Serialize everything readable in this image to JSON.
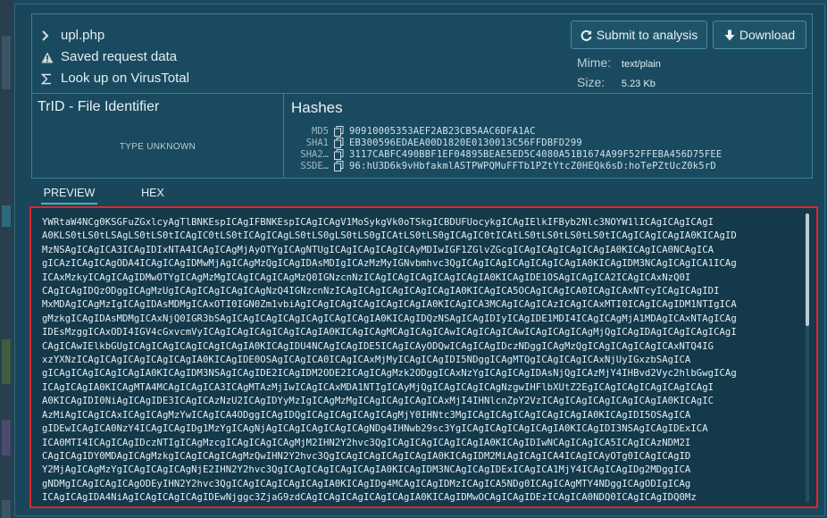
{
  "file": {
    "name": "upl.php",
    "actions": [
      {
        "label": "Saved request data",
        "icon": "warning-icon"
      },
      {
        "label": "Look up on VirusTotal",
        "icon": "sigma-icon"
      }
    ]
  },
  "buttons": {
    "submit_label": "Submit to analysis",
    "download_label": "Download"
  },
  "meta": {
    "mime_label": "Mime:",
    "mime_value": "text/plain",
    "size_label": "Size:",
    "size_value": "5.23 Kb"
  },
  "trid": {
    "title": "TrID - File Identifier",
    "type_text": "TYPE UNKNOWN"
  },
  "hashes": {
    "title": "Hashes",
    "rows": [
      {
        "label": "MD5",
        "value": "90910005353AEF2AB23CB5AAC6DFA1AC"
      },
      {
        "label": "SHA1",
        "value": "EB300596EDAEA00D1820E0130013C56FFDBFD299"
      },
      {
        "label": "SHA2…",
        "value": "3117CABFC490BBF1EF04895BEAE5ED5C4080A51B1674A99F52FFEBA456D75FEE"
      },
      {
        "label": "SSDE…",
        "value": "96:hU3D6k9vHbfakmlASTPWPQMuFFTb1PZtYtcZ0HEQk6sD:hoTePZtUcZ0k5rD"
      }
    ]
  },
  "tabs": {
    "preview": "PREVIEW",
    "hex": "HEX"
  },
  "preview": {
    "lines": [
      "YWRtaW4NCg0KSGFuZGxlcyAgTlBNKEspICAgIFBNKEspICAgICAgV1MoSykgVk0oTSkgICBDUFUocykgICAgIElkIFByb2Nlc3NOYW1lICAgICAgICAgI",
      "A0KLS0tLS0tLSAgLS0tLS0tICAgIC0tLS0tICAgICAgLS0tLS0gLS0tLS0gICAtLS0tLS0gICAgIC0tICAtLS0tLS0tLS0tLS0tICAgICAgICAgIA0KICAgID",
      "MzNSAgICAgICA3ICAgIDIxNTA4ICAgICAgMjAyOTYgICAgNTUgICAgICAgICAgICAyMDIwIGF1ZGlvZGcgICAgICAgICAgICAgIA0KICAgICA0NCAgICA",
      "gICAzICAgICAgODA4ICAgICAgIDMwMjAgICAgMzQgICAgIDAsMDIgICAzMzMyIGNvbmhvc3QgICAgICAgICAgICAgICAgIA0KICAgIDM3NCAgICAgICA1ICAg",
      "ICAxMzkyICAgICAgIDMwOTYgICAgMzMgICAgICAgICAgMzQ0IGNzcnNzICAgICAgICAgICAgICAgIA0KICAgIDE1OSAgICAgICA2ICAgICAxNzQ0I",
      "CAgICAgIDQzODggICAgMzUgICAgICAgICAgICAgNzQ4IGNzcnNzICAgICAgICAgICAgICAgIA0KICAgICA5OCAgICAgICA0ICAgICAxNTcyICAgICAgIDI",
      "MxMDAgICAgMzIgICAgIDAsMDMgICAxOTI0IGN0Zm1vbiAgICAgICAgICAgICAgICAgIA0KICAgICA3MCAgICAgICAzICAgICAxMTI0ICAgICAgIDM1NTIgICA",
      "gMzkgICAgIDAsMDMgICAxNjQ0IGR3bSAgICAgICAgICAgICAgICAgICAgIA0KICAgIDQzNSAgICAgIDIyICAgIDE1MDI4ICAgICAgMjA1MDAgICAxNTAgICAg",
      "IDEsMzggICAxODI4IGV4cGxvcmVyICAgICAgICAgICAgICAgIA0KICAgICAgMCAgICAgICAwICAgICAgICAwICAgICAgICAgMjQgICAgIDAgICAgICAgICAgI",
      "CAgICAwIElkbGUgICAgICAgICAgICAgICAgIA0KICAgIDU4NCAgICAgIDE5ICAgICAyODQwICAgICAgIDczNDggICAgMzQgICAgICAgICAgICAxNTQ4IG",
      "xzYXNzICAgICAgICAgICAgICAgIA0KICAgIDE0OSAgICAgICA0ICAgICAxMjMyICAgICAgIDI5NDggICAgMTQgICAgICAgICAxNjUyIGxzbSAgICA",
      "gICAgICAgICAgICAgIA0KICAgIDM3NSAgICAgIDE2ICAgIDM2ODE2ICAgICAgMzk2ODggICAxNzYgICAgICAgIDAsNjQgICAzMjY4IHBvd2Vyc2hlbGwgICAg",
      "ICAgICAgIA0KICAgMTA4MCAgICAgICA3ICAgMTAzMjIwICAgICAxMDA1NTIgICAyMjQgICAgICAgICAgNzgwIHFlbXUtZ2EgICAgICAgICAgICAgICAgI",
      "A0KICAgIDI0NiAgICAgIDE3ICAgICAzNzU2ICAgIDYyMzIgICAgMzMgICAgICAgICAgICAxMjI4IHNlcnZpY2VzICAgICAgICAgICAgICAgIA0KICAgIC",
      "AzMiAgICAgICAxICAgICAgMzYwICAgICA4ODggICAgIDQgICAgICAgICAgICAgMjY0IHNtc3MgICAgICAgICAgICAgICAgIA0KICAgIDI5OSAgICA",
      "gIDEwICAgICA0NzY4ICAgICAgIDg1MzYgICAgNjAgICAgICAgICAgICAgNDg4IHNwb29sc3YgICAgICAgICAgICAgIA0KICAgIDI3NSAgICAgIDExICA",
      "ICA0MTI4ICAgICAgIDczNTIgICAgMzcgICAgICAgICAgMjM2IHN2Y2hvc3QgICAgICAgICAgICAgIA0KICAgIDIwNCAgICAgICA5ICAgICAzNDM2I",
      "CAgICAgIDY0MDAgICAgMzkgICAgICAgICAgMzQwIHN2Y2hvc3QgICAgICAgICAgICAgIA0KICAgIDM2MiAgICAgICA4ICAgICAyOTg0ICAgICAgID",
      "Y2MjAgICAgMzYgICAgICAgICAgNjE2IHN2Y2hvc3QgICAgICAgICAgICAgIA0KICAgIDM3NCAgICAgIDExICAgICA1MjY4ICAgICAgIDg2MDggICA",
      "gNDMgICAgICAgICAgODEyIHN2Y2hvc3QgICAgICAgICAgICAgIA0KICAgIDg4MCAgICAgIDMzICAgICA5NDg0ICAgICAgMTY4NDggICAgODIgICAg",
      "ICAgICAgIDA4NiAgICAgICAgICAgIDEwNjggc3ZjaG9zdCAgICAgICAgICAgICAgIA0KICAgIDMwOCAgICAgIDEzICAgICA0NDQ0ICAgICAgIDQ0Mz"
    ]
  }
}
